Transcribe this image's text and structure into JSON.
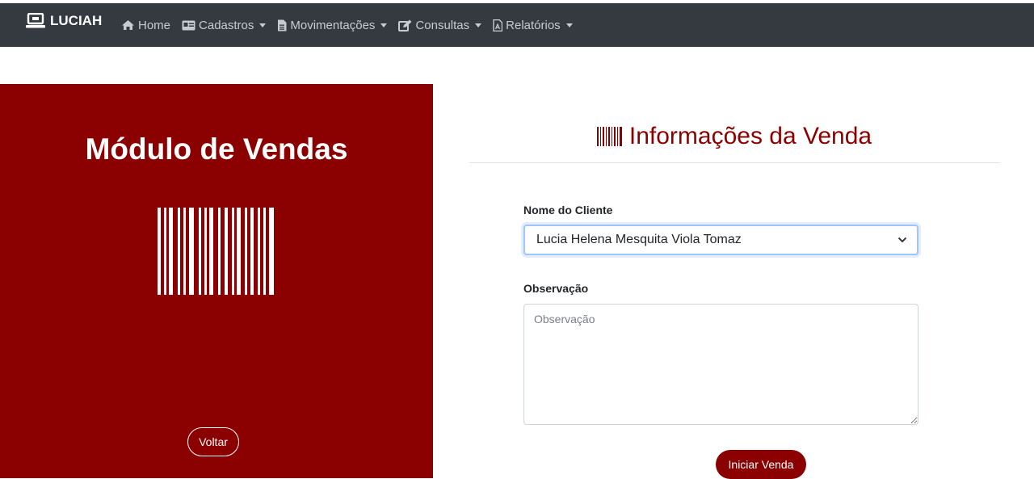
{
  "brand": {
    "name": "LUCIAH",
    "icon": "laptop-icon"
  },
  "nav": [
    {
      "label": "Home",
      "icon": "home-icon",
      "dropdown": false
    },
    {
      "label": "Cadastros",
      "icon": "id-card-icon",
      "dropdown": true
    },
    {
      "label": "Movimentações",
      "icon": "file-icon",
      "dropdown": true
    },
    {
      "label": "Consultas",
      "icon": "edit-icon",
      "dropdown": true
    },
    {
      "label": "Relatórios",
      "icon": "pdf-icon",
      "dropdown": true
    }
  ],
  "left": {
    "title": "Módulo de Vendas",
    "back_label": "Voltar"
  },
  "main": {
    "title": "Informações da Venda",
    "cliente_label": "Nome do Cliente",
    "cliente_value": "Lucia Helena Mesquita Viola Tomaz",
    "obs_label": "Observação",
    "obs_placeholder": "Observação",
    "start_label": "Iniciar Venda"
  },
  "colors": {
    "navbar": "#343a40",
    "accent": "#8b0000",
    "nav_text": "#c8cbcf"
  }
}
